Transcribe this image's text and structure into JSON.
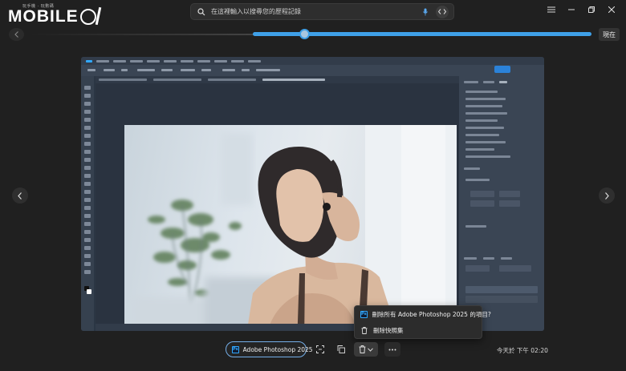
{
  "brand": {
    "logo_text": "MOBILE",
    "logo_sub": "玩手機 · 玩數碼"
  },
  "search": {
    "placeholder": "在這裡輸入以搜尋您的歷程記錄"
  },
  "timeline": {
    "now_label": "現在",
    "position": 0.52
  },
  "context_menu": {
    "items": [
      {
        "icon": "photoshop-icon",
        "label": "刪除所有 Adobe Photoshop 2025 的項目?"
      },
      {
        "icon": "trash-icon",
        "label": "刪除快照集"
      }
    ]
  },
  "bottom_bar": {
    "app_badge": "Ps",
    "app_label": "Adobe Photoshop 2025",
    "timestamp": "今天於 下午 02:20"
  },
  "colors": {
    "accent": "#3fa0e8",
    "background": "#202020",
    "photoshop_blue": "#31a8ff"
  }
}
